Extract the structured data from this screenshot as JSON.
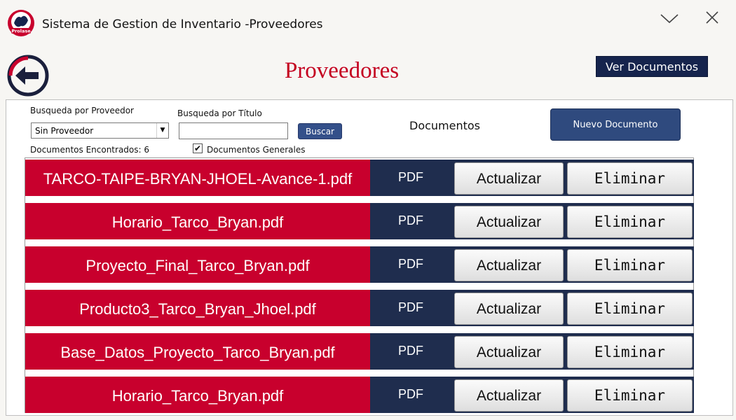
{
  "app": {
    "title": "Sistema de Gestion de Inventario -Proveedores",
    "logo_text": "Prolase",
    "window_controls": [
      "chevron-down-icon",
      "close-icon"
    ]
  },
  "header": {
    "page_title": "Proveedores",
    "ver_documentos_label": "Ver Documentos"
  },
  "filters": {
    "proveedor_label": "Busqueda por Proveedor",
    "proveedor_value": "Sin Proveedor",
    "titulo_label": "Busqueda por Título",
    "titulo_value": "",
    "buscar_label": "Buscar",
    "found_label": "Documentos Encontrados: 6",
    "generales_label": "Documentos Generales",
    "generales_checked": true
  },
  "documents_section": {
    "label": "Documentos",
    "nuevo_label": "Nuevo Documento"
  },
  "documents": [
    {
      "name": "TARCO-TAIPE-BRYAN-JHOEL-Avance-1.pdf",
      "type": "PDF",
      "update_label": "Actualizar",
      "delete_label": "Eliminar"
    },
    {
      "name": "Horario_Tarco_Bryan.pdf",
      "type": "PDF",
      "update_label": "Actualizar",
      "delete_label": "Eliminar"
    },
    {
      "name": "Proyecto_Final_Tarco_Bryan.pdf",
      "type": "PDF",
      "update_label": "Actualizar",
      "delete_label": "Eliminar"
    },
    {
      "name": "Producto3_Tarco_Bryan_Jhoel.pdf",
      "type": "PDF",
      "update_label": "Actualizar",
      "delete_label": "Eliminar"
    },
    {
      "name": "Base_Datos_Proyecto_Tarco_Bryan.pdf",
      "type": "PDF",
      "update_label": "Actualizar",
      "delete_label": "Eliminar"
    },
    {
      "name": "Horario_Tarco_Bryan.pdf",
      "type": "PDF",
      "update_label": "Actualizar",
      "delete_label": "Eliminar"
    }
  ],
  "colors": {
    "accent_red": "#c8002d",
    "navy": "#1f2d4e",
    "title_red": "#c40020"
  }
}
